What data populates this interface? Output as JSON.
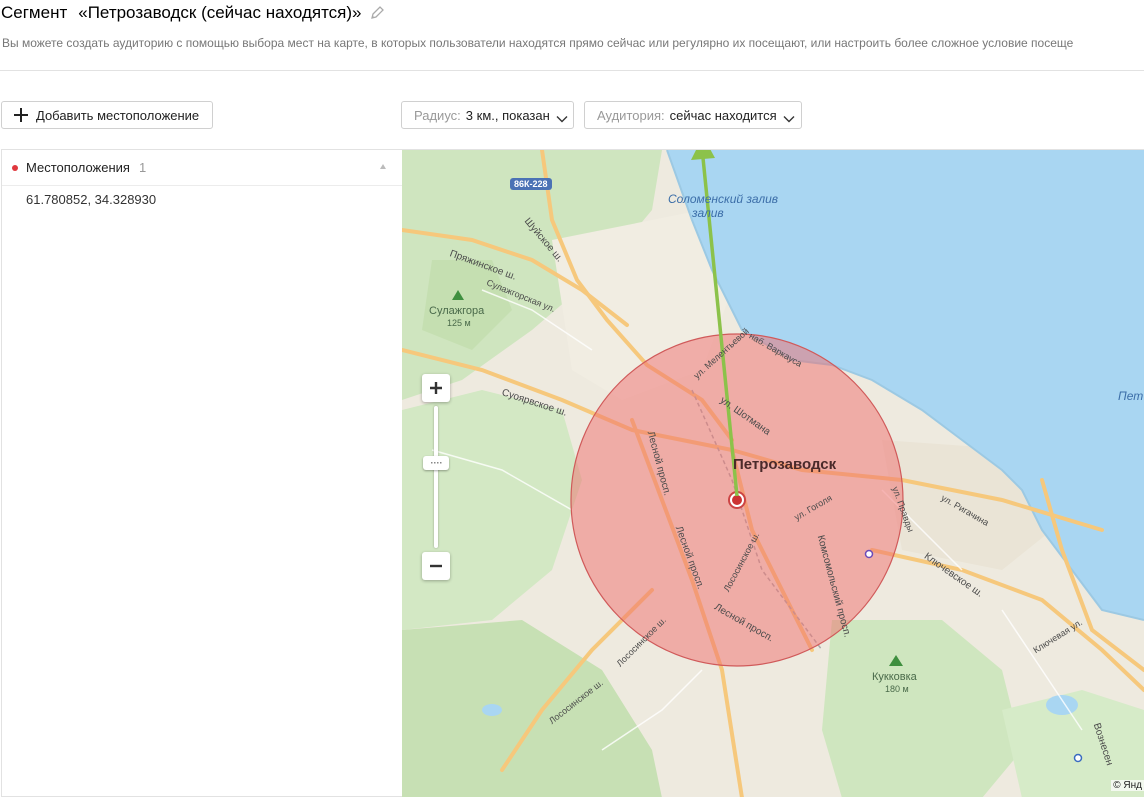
{
  "header": {
    "segment_label": "Сегмент",
    "segment_name": "«Петрозаводск (сейчас находятся)»",
    "description": "Вы можете создать аудиторию с помощью выбора мест на карте, в которых пользователи находятся прямо сейчас или регулярно их посещают, или настроить более сложное условие посеще"
  },
  "toolbar": {
    "add_location_label": "Добавить местоположение",
    "radius_label": "Радиус:",
    "radius_value": "3 км., показан",
    "audience_label": "Аудитория:",
    "audience_value": "сейчас находится"
  },
  "sidebar": {
    "title": "Местоположения",
    "count": "1",
    "items": [
      {
        "coords": "61.780852, 34.328930"
      }
    ]
  },
  "map": {
    "city": "Петрозаводск",
    "labels": {
      "road_badge": "86К-228",
      "bay": "Соломенский залив",
      "bay_line2": "залив",
      "sulazhgora": "Сулажгора",
      "sulazhgora_alt": "125 м",
      "kukkovka": "Кукковка",
      "kukkovka_alt": "180 м",
      "lake": "Пет",
      "shuyskoe": "Шуйское ш.",
      "pryazhinskoe": "Пряжинское ш.",
      "sulazhgorskaya": "Сулажгорская ул.",
      "suoyarvskoe": "Суоярвское ш.",
      "lesnoy1": "Лесной просп.",
      "lesnoy2": "Лесной просп.",
      "lesnoy3": "Лесной просп.",
      "shotmana": "ул. Шотмана",
      "meletskoy": "ул. Мелентьевой",
      "kareli": "наб. Варкауса",
      "gogolya": "ул. Гоголя",
      "komsomolsky": "Комсомольский просп.",
      "lososinskoe1": "Лососинское ш.",
      "lososinskoe2": "Лососинское ш.",
      "lososinskoe3": "Лососинское ш.",
      "pravdy": "ул. Правды",
      "rigachina": "ул. Ригачина",
      "klyuchevskoe": "Ключевское ш.",
      "klyuchevaya": "Ключевая ул.",
      "voznesensk": "Вознесен",
      "copyright": "© Янд"
    },
    "radius_color": "#f08080",
    "arrow_color": "#8cc24a"
  }
}
